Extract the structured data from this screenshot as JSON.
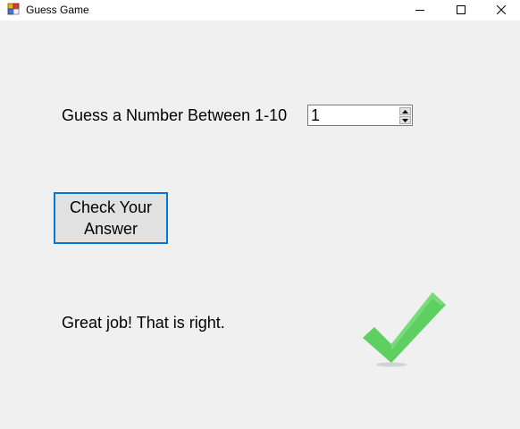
{
  "window": {
    "title": "Guess Game",
    "icons": {
      "app": "app-icon",
      "minimize": "minimize-icon",
      "maximize": "maximize-icon",
      "close": "close-icon"
    }
  },
  "form": {
    "prompt_label": "Guess a Number Between 1-10",
    "guess_value": "1",
    "check_button_label": "Check Your Answer",
    "result_text": "Great job! That is right.",
    "result_icon": "checkmark-icon"
  },
  "colors": {
    "accent": "#0078d7",
    "checkmark": "#5ecf61",
    "background": "#f0f0f0"
  }
}
